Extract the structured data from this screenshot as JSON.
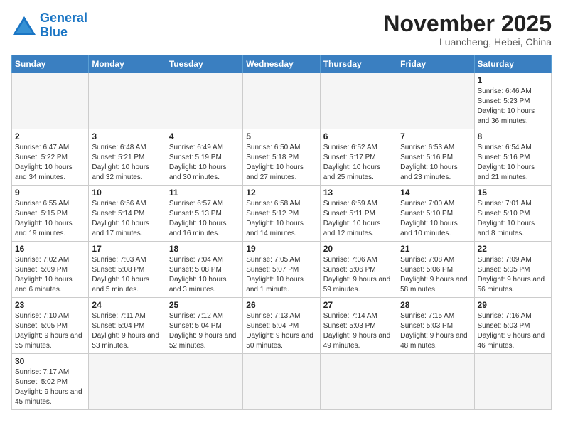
{
  "logo": {
    "line1": "General",
    "line2": "Blue"
  },
  "title": "November 2025",
  "subtitle": "Luancheng, Hebei, China",
  "weekdays": [
    "Sunday",
    "Monday",
    "Tuesday",
    "Wednesday",
    "Thursday",
    "Friday",
    "Saturday"
  ],
  "weeks": [
    [
      {
        "day": "",
        "info": ""
      },
      {
        "day": "",
        "info": ""
      },
      {
        "day": "",
        "info": ""
      },
      {
        "day": "",
        "info": ""
      },
      {
        "day": "",
        "info": ""
      },
      {
        "day": "",
        "info": ""
      },
      {
        "day": "1",
        "info": "Sunrise: 6:46 AM\nSunset: 5:23 PM\nDaylight: 10 hours and 36 minutes."
      }
    ],
    [
      {
        "day": "2",
        "info": "Sunrise: 6:47 AM\nSunset: 5:22 PM\nDaylight: 10 hours and 34 minutes."
      },
      {
        "day": "3",
        "info": "Sunrise: 6:48 AM\nSunset: 5:21 PM\nDaylight: 10 hours and 32 minutes."
      },
      {
        "day": "4",
        "info": "Sunrise: 6:49 AM\nSunset: 5:19 PM\nDaylight: 10 hours and 30 minutes."
      },
      {
        "day": "5",
        "info": "Sunrise: 6:50 AM\nSunset: 5:18 PM\nDaylight: 10 hours and 27 minutes."
      },
      {
        "day": "6",
        "info": "Sunrise: 6:52 AM\nSunset: 5:17 PM\nDaylight: 10 hours and 25 minutes."
      },
      {
        "day": "7",
        "info": "Sunrise: 6:53 AM\nSunset: 5:16 PM\nDaylight: 10 hours and 23 minutes."
      },
      {
        "day": "8",
        "info": "Sunrise: 6:54 AM\nSunset: 5:16 PM\nDaylight: 10 hours and 21 minutes."
      }
    ],
    [
      {
        "day": "9",
        "info": "Sunrise: 6:55 AM\nSunset: 5:15 PM\nDaylight: 10 hours and 19 minutes."
      },
      {
        "day": "10",
        "info": "Sunrise: 6:56 AM\nSunset: 5:14 PM\nDaylight: 10 hours and 17 minutes."
      },
      {
        "day": "11",
        "info": "Sunrise: 6:57 AM\nSunset: 5:13 PM\nDaylight: 10 hours and 16 minutes."
      },
      {
        "day": "12",
        "info": "Sunrise: 6:58 AM\nSunset: 5:12 PM\nDaylight: 10 hours and 14 minutes."
      },
      {
        "day": "13",
        "info": "Sunrise: 6:59 AM\nSunset: 5:11 PM\nDaylight: 10 hours and 12 minutes."
      },
      {
        "day": "14",
        "info": "Sunrise: 7:00 AM\nSunset: 5:10 PM\nDaylight: 10 hours and 10 minutes."
      },
      {
        "day": "15",
        "info": "Sunrise: 7:01 AM\nSunset: 5:10 PM\nDaylight: 10 hours and 8 minutes."
      }
    ],
    [
      {
        "day": "16",
        "info": "Sunrise: 7:02 AM\nSunset: 5:09 PM\nDaylight: 10 hours and 6 minutes."
      },
      {
        "day": "17",
        "info": "Sunrise: 7:03 AM\nSunset: 5:08 PM\nDaylight: 10 hours and 5 minutes."
      },
      {
        "day": "18",
        "info": "Sunrise: 7:04 AM\nSunset: 5:08 PM\nDaylight: 10 hours and 3 minutes."
      },
      {
        "day": "19",
        "info": "Sunrise: 7:05 AM\nSunset: 5:07 PM\nDaylight: 10 hours and 1 minute."
      },
      {
        "day": "20",
        "info": "Sunrise: 7:06 AM\nSunset: 5:06 PM\nDaylight: 9 hours and 59 minutes."
      },
      {
        "day": "21",
        "info": "Sunrise: 7:08 AM\nSunset: 5:06 PM\nDaylight: 9 hours and 58 minutes."
      },
      {
        "day": "22",
        "info": "Sunrise: 7:09 AM\nSunset: 5:05 PM\nDaylight: 9 hours and 56 minutes."
      }
    ],
    [
      {
        "day": "23",
        "info": "Sunrise: 7:10 AM\nSunset: 5:05 PM\nDaylight: 9 hours and 55 minutes."
      },
      {
        "day": "24",
        "info": "Sunrise: 7:11 AM\nSunset: 5:04 PM\nDaylight: 9 hours and 53 minutes."
      },
      {
        "day": "25",
        "info": "Sunrise: 7:12 AM\nSunset: 5:04 PM\nDaylight: 9 hours and 52 minutes."
      },
      {
        "day": "26",
        "info": "Sunrise: 7:13 AM\nSunset: 5:04 PM\nDaylight: 9 hours and 50 minutes."
      },
      {
        "day": "27",
        "info": "Sunrise: 7:14 AM\nSunset: 5:03 PM\nDaylight: 9 hours and 49 minutes."
      },
      {
        "day": "28",
        "info": "Sunrise: 7:15 AM\nSunset: 5:03 PM\nDaylight: 9 hours and 48 minutes."
      },
      {
        "day": "29",
        "info": "Sunrise: 7:16 AM\nSunset: 5:03 PM\nDaylight: 9 hours and 46 minutes."
      }
    ],
    [
      {
        "day": "30",
        "info": "Sunrise: 7:17 AM\nSunset: 5:02 PM\nDaylight: 9 hours and 45 minutes."
      },
      {
        "day": "",
        "info": ""
      },
      {
        "day": "",
        "info": ""
      },
      {
        "day": "",
        "info": ""
      },
      {
        "day": "",
        "info": ""
      },
      {
        "day": "",
        "info": ""
      },
      {
        "day": "",
        "info": ""
      }
    ]
  ]
}
